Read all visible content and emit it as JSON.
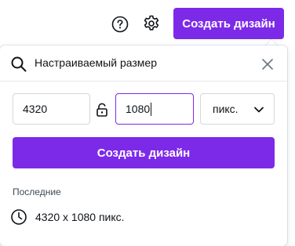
{
  "topbar": {
    "help_icon": "question-circle-icon",
    "settings_icon": "gear-icon",
    "create_label": "Создать дизайн"
  },
  "panel": {
    "search": {
      "value": "Настраиваемый размер",
      "icon": "search-icon",
      "clear_icon": "close-icon"
    },
    "width": {
      "value": "4320"
    },
    "height": {
      "value": "1080"
    },
    "lock_icon": "unlocked-padlock-icon",
    "unit": {
      "selected": "пикс.",
      "icon": "chevron-down-icon"
    },
    "create_label": "Создать дизайн",
    "recent": {
      "heading": "Последние",
      "items": [
        {
          "label": "4320 x 1080 пикс.",
          "icon": "clock-icon"
        }
      ]
    }
  },
  "colors": {
    "accent": "#7d2ae8",
    "text": "#0e1318",
    "border": "#d3d7dc"
  }
}
